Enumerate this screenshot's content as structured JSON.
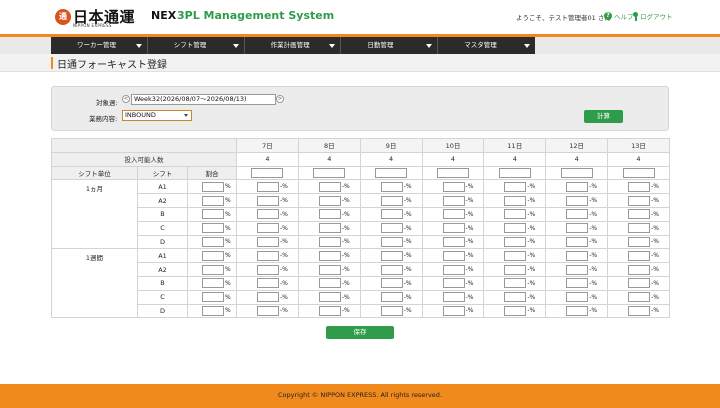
{
  "header": {
    "logo_mark": "通",
    "logo_text": "日本通運",
    "logo_sub": "NIPPON EXPRESS",
    "system_prefix": "NEX",
    "system_name": "3PL Management System",
    "welcome": "ようこそ、テスト管理者01 さん",
    "help": "ヘルプ",
    "logout": "ログアウト"
  },
  "nav": {
    "items": [
      "ワーカー管理",
      "シフト管理",
      "作業計画管理",
      "日勤管理",
      "マスタ管理"
    ]
  },
  "page": {
    "title": "日通フォーキャスト登録"
  },
  "filters": {
    "week_label": "対象週:",
    "week_value": "Week32(2026/08/07〜2026/08/13)",
    "type_label": "業務内容:",
    "type_value": "INBOUND",
    "calc_button": "計算"
  },
  "table": {
    "days": [
      "7日",
      "8日",
      "9日",
      "10日",
      "11日",
      "12日",
      "13日"
    ],
    "capacity_label": "投入可能人数",
    "capacity_values": [
      "4",
      "4",
      "4",
      "4",
      "4",
      "4",
      "4"
    ],
    "col_unit": "シフト単位",
    "col_shift": "シフト",
    "col_ratio": "割合",
    "groups": [
      {
        "unit": "1ヵ月",
        "shifts": [
          "A1",
          "A2",
          "B",
          "C",
          "D"
        ]
      },
      {
        "unit": "1週間",
        "shifts": [
          "A1",
          "A2",
          "B",
          "C",
          "D"
        ]
      }
    ],
    "pct_sign": "%",
    "cell_suffix": "-%"
  },
  "save_button": "保存",
  "footer": {
    "copyright": "Copyright © NIPPON EXPRESS. All rights reserved."
  },
  "colors": {
    "accent_orange": "#f08a1c",
    "brand_green": "#2e9c4b",
    "nav_dark": "#2b2b2b"
  }
}
